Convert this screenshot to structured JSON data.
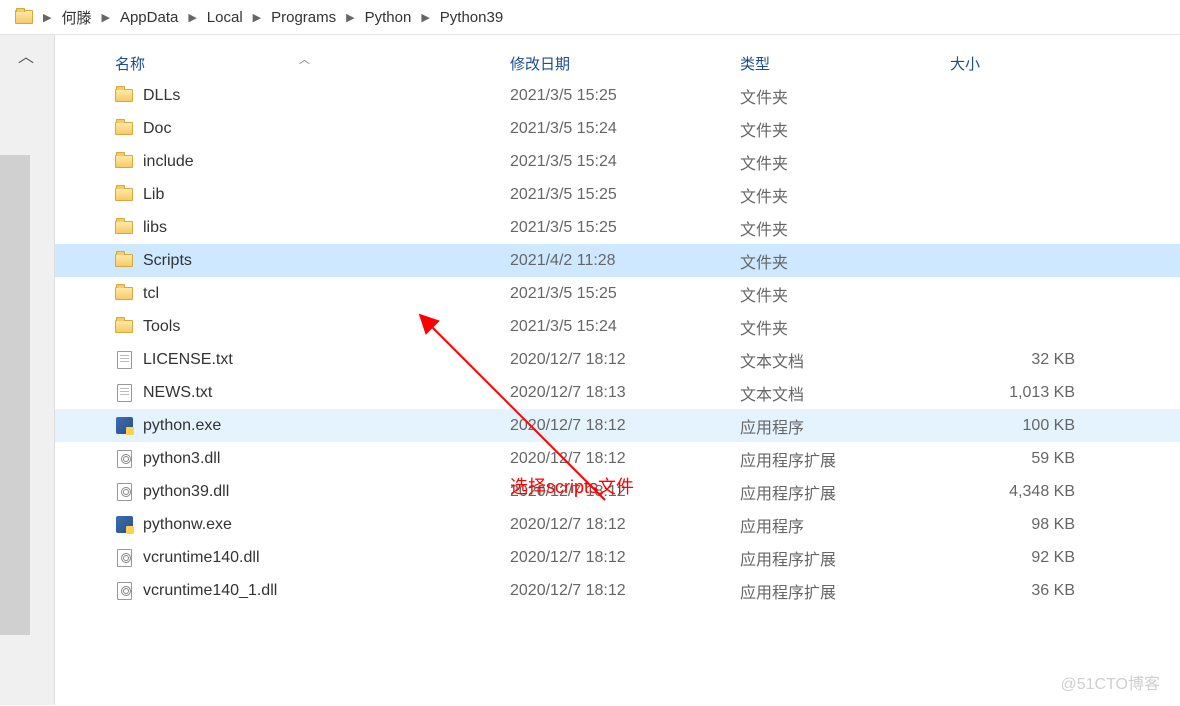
{
  "breadcrumb": [
    "何滕",
    "AppData",
    "Local",
    "Programs",
    "Python",
    "Python39"
  ],
  "columns": {
    "name": "名称",
    "date": "修改日期",
    "type": "类型",
    "size": "大小"
  },
  "types": {
    "folder": "文件夹",
    "txt": "文本文档",
    "exe": "应用程序",
    "dll": "应用程序扩展"
  },
  "files": [
    {
      "icon": "folder",
      "name": "DLLs",
      "date": "2021/3/5 15:25",
      "typeKey": "folder",
      "size": "",
      "state": ""
    },
    {
      "icon": "folder",
      "name": "Doc",
      "date": "2021/3/5 15:24",
      "typeKey": "folder",
      "size": "",
      "state": ""
    },
    {
      "icon": "folder",
      "name": "include",
      "date": "2021/3/5 15:24",
      "typeKey": "folder",
      "size": "",
      "state": ""
    },
    {
      "icon": "folder",
      "name": "Lib",
      "date": "2021/3/5 15:25",
      "typeKey": "folder",
      "size": "",
      "state": ""
    },
    {
      "icon": "folder",
      "name": "libs",
      "date": "2021/3/5 15:25",
      "typeKey": "folder",
      "size": "",
      "state": ""
    },
    {
      "icon": "folder",
      "name": "Scripts",
      "date": "2021/4/2 11:28",
      "typeKey": "folder",
      "size": "",
      "state": "sel"
    },
    {
      "icon": "folder",
      "name": "tcl",
      "date": "2021/3/5 15:25",
      "typeKey": "folder",
      "size": "",
      "state": ""
    },
    {
      "icon": "folder",
      "name": "Tools",
      "date": "2021/3/5 15:24",
      "typeKey": "folder",
      "size": "",
      "state": ""
    },
    {
      "icon": "txt",
      "name": "LICENSE.txt",
      "date": "2020/12/7 18:12",
      "typeKey": "txt",
      "size": "32 KB",
      "state": ""
    },
    {
      "icon": "txt",
      "name": "NEWS.txt",
      "date": "2020/12/7 18:13",
      "typeKey": "txt",
      "size": "1,013 KB",
      "state": ""
    },
    {
      "icon": "exe",
      "name": "python.exe",
      "date": "2020/12/7 18:12",
      "typeKey": "exe",
      "size": "100 KB",
      "state": "hov"
    },
    {
      "icon": "dll",
      "name": "python3.dll",
      "date": "2020/12/7 18:12",
      "typeKey": "dll",
      "size": "59 KB",
      "state": ""
    },
    {
      "icon": "dll",
      "name": "python39.dll",
      "date": "2020/12/7 18:12",
      "typeKey": "dll",
      "size": "4,348 KB",
      "state": ""
    },
    {
      "icon": "exe",
      "name": "pythonw.exe",
      "date": "2020/12/7 18:12",
      "typeKey": "exe",
      "size": "98 KB",
      "state": ""
    },
    {
      "icon": "dll",
      "name": "vcruntime140.dll",
      "date": "2020/12/7 18:12",
      "typeKey": "dll",
      "size": "92 KB",
      "state": ""
    },
    {
      "icon": "dll",
      "name": "vcruntime140_1.dll",
      "date": "2020/12/7 18:12",
      "typeKey": "dll",
      "size": "36 KB",
      "state": ""
    }
  ],
  "annotation": "选择scripts文件",
  "watermark": "@51CTO博客"
}
